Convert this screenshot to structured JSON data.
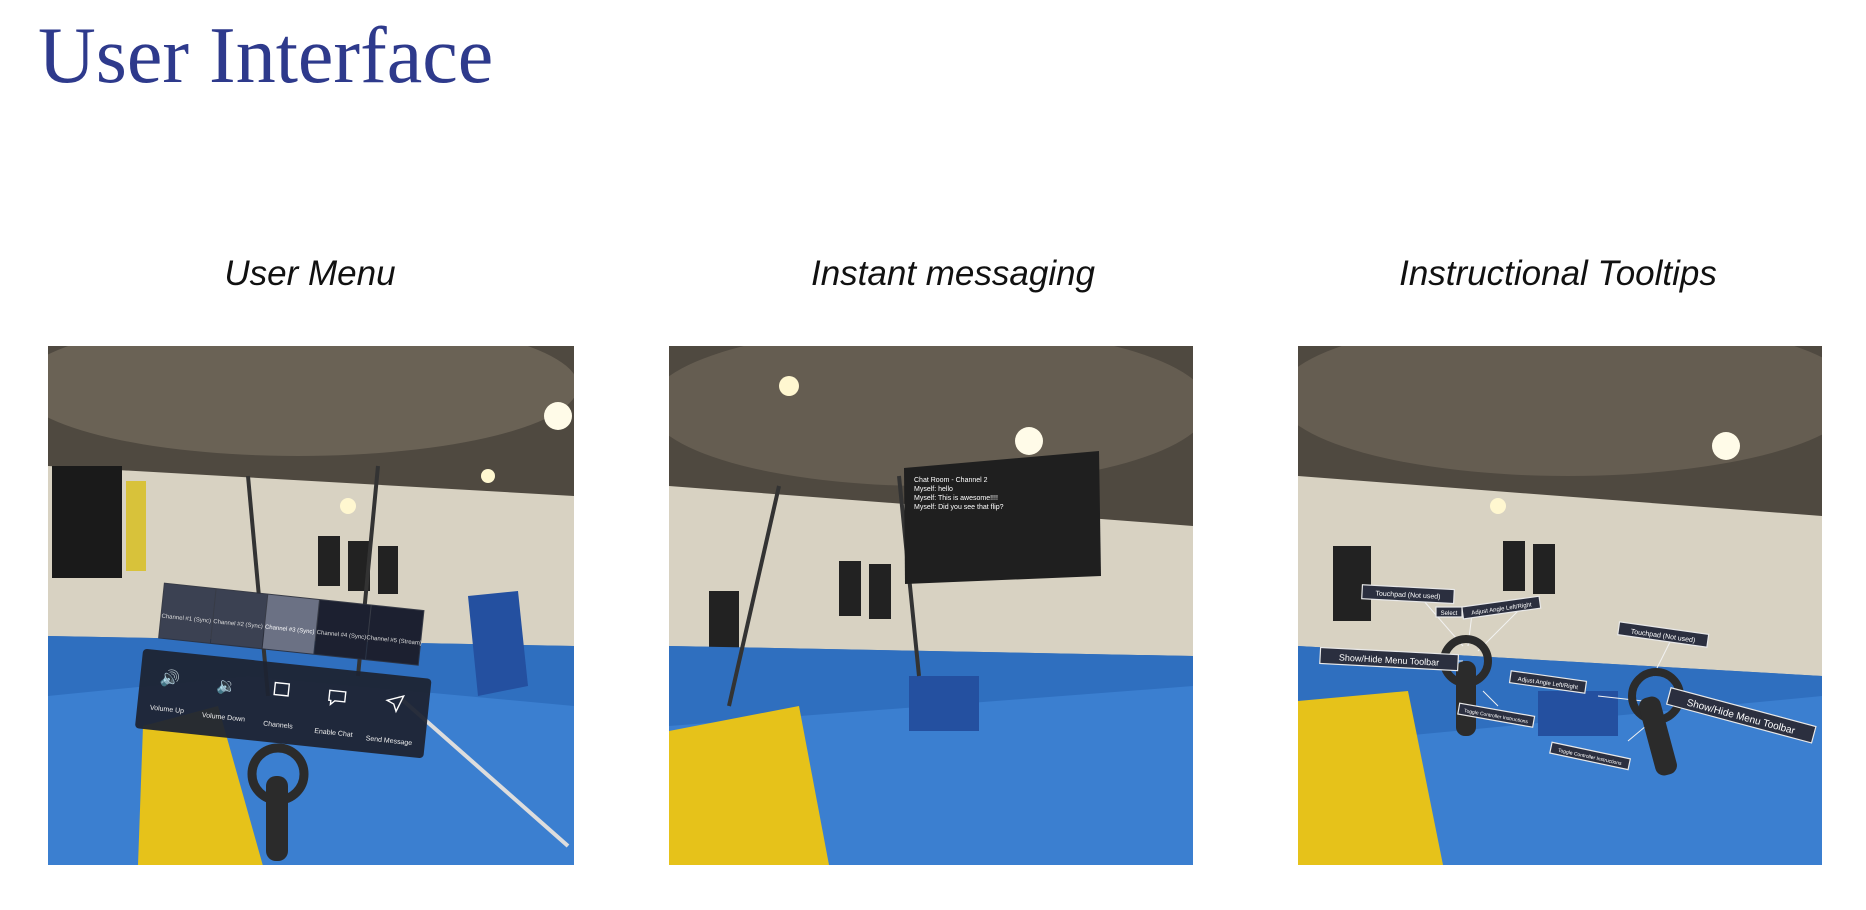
{
  "page": {
    "title": "User Interface"
  },
  "panels": [
    {
      "caption": "User Menu",
      "menu": {
        "channels": [
          "Channel #1 (Sync)",
          "Channel #2 (Sync)",
          "Channel #3 (Sync)",
          "Channel #4 (Sync)",
          "Channel #5 (Stream)"
        ],
        "buttons": [
          {
            "label": "Volume Up",
            "icon": "volume-up-icon"
          },
          {
            "label": "Volume Down",
            "icon": "volume-down-icon"
          },
          {
            "label": "Channels",
            "icon": "channels-icon"
          },
          {
            "label": "Enable Chat",
            "icon": "chat-icon"
          },
          {
            "label": "Send Message",
            "icon": "send-icon"
          }
        ]
      }
    },
    {
      "caption": "Instant messaging",
      "chat": {
        "header": "Chat Room - Channel 2",
        "lines": [
          "Myself: hello",
          "Myself: This is awesome!!!!",
          "Myself: Did you see that flip?"
        ]
      }
    },
    {
      "caption": "Instructional Tooltips",
      "tooltips": {
        "touchpad": "Touchpad (Not used)",
        "select": "Select",
        "adjust_angle": "Adjust Angle Left/Right",
        "show_hide": "Show/Hide Menu Toolbar",
        "toggle": "Toggle Controller Instructions"
      }
    }
  ],
  "colors": {
    "title": "#2e3a8c",
    "mat_blue": "#2f6fbf",
    "pad_yellow": "#e6c21a",
    "ceiling": "#5a534a",
    "wall": "#d9d4c6",
    "menu_panel": "#1e2433"
  }
}
